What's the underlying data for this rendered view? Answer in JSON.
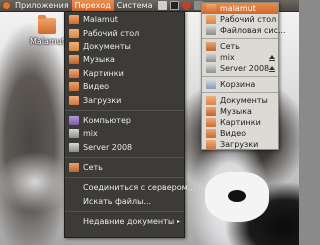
{
  "top_panel": {
    "menus": [
      {
        "label": "Приложения"
      },
      {
        "label": "Переход"
      },
      {
        "label": "Система"
      }
    ]
  },
  "desktop": {
    "icons": [
      {
        "label": "Malamut",
        "icon": "home-folder-icon"
      }
    ]
  },
  "places_menu": {
    "items": [
      {
        "label": "Malamut",
        "icon": "home-folder-icon"
      },
      {
        "label": "Рабочий стол",
        "icon": "desktop-folder-icon"
      },
      {
        "label": "Документы",
        "icon": "documents-folder-icon"
      },
      {
        "label": "Музыка",
        "icon": "music-folder-icon"
      },
      {
        "label": "Картинки",
        "icon": "pictures-folder-icon"
      },
      {
        "label": "Видео",
        "icon": "videos-folder-icon"
      },
      {
        "label": "Загрузки",
        "icon": "downloads-folder-icon"
      },
      {
        "label": "Компьютер",
        "icon": "computer-icon"
      },
      {
        "label": "mix",
        "icon": "drive-icon"
      },
      {
        "label": "Server 2008",
        "icon": "drive-icon"
      },
      {
        "label": "Сеть",
        "icon": "network-icon"
      },
      {
        "label": "Соединиться с сервером..."
      },
      {
        "label": "Искать файлы..."
      },
      {
        "label": "Недавние документы",
        "submenu": "▸"
      }
    ]
  },
  "mounts_menu": {
    "items": [
      {
        "label": "malamut",
        "icon": "home-folder-icon"
      },
      {
        "label": "Рабочий стол",
        "icon": "desktop-folder-icon"
      },
      {
        "label": "Файловая сис...",
        "icon": "filesystem-icon"
      },
      {
        "label": "Сеть",
        "icon": "network-icon"
      },
      {
        "label": "mix",
        "icon": "drive-icon"
      },
      {
        "label": "Server 2008",
        "icon": "drive-icon"
      },
      {
        "label": "Корзина",
        "icon": "trash-icon"
      },
      {
        "label": "Документы",
        "icon": "documents-folder-icon"
      },
      {
        "label": "Музыка",
        "icon": "music-folder-icon"
      },
      {
        "label": "Картинки",
        "icon": "pictures-folder-icon"
      },
      {
        "label": "Видео",
        "icon": "videos-folder-icon"
      },
      {
        "label": "Загрузки",
        "icon": "downloads-folder-icon"
      }
    ]
  },
  "colors": {
    "panel": "#4e4b46",
    "highlight": "#d3682b",
    "menu_bg": "#3c3b37",
    "menu_light_bg": "#dcdad5"
  }
}
